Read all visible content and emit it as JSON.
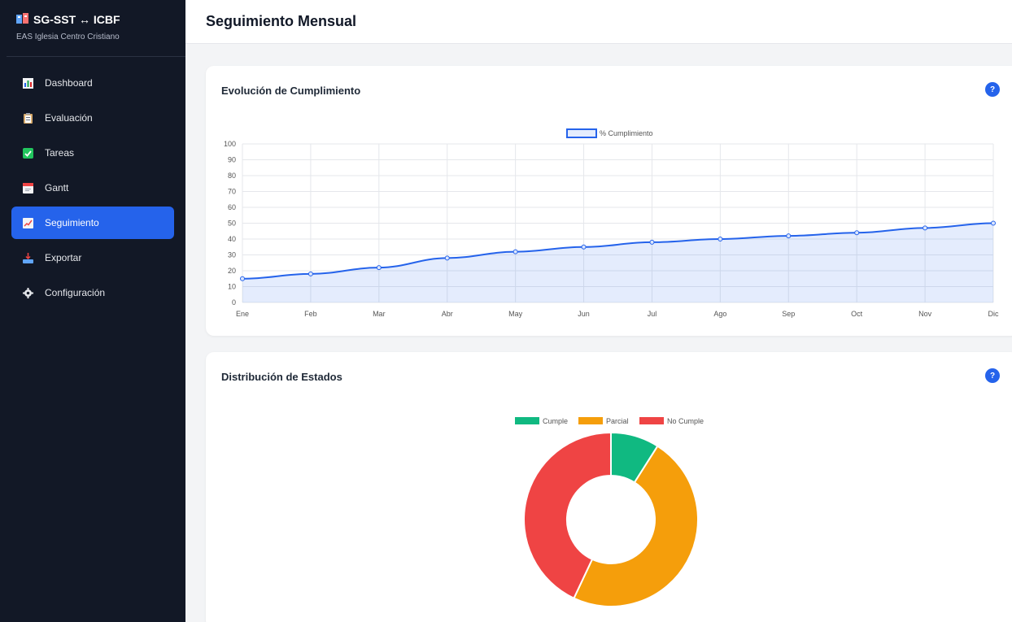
{
  "app": {
    "title": "SG-SST ↔ ICBF",
    "subtitle": "EAS Iglesia Centro Cristiano"
  },
  "sidebar": {
    "items": [
      {
        "label": "Dashboard",
        "icon": "bar-chart-icon",
        "active": false
      },
      {
        "label": "Evaluación",
        "icon": "clipboard-icon",
        "active": false
      },
      {
        "label": "Tareas",
        "icon": "check-icon",
        "active": false
      },
      {
        "label": "Gantt",
        "icon": "calendar-icon",
        "active": false
      },
      {
        "label": "Seguimiento",
        "icon": "trend-chart-icon",
        "active": true
      },
      {
        "label": "Exportar",
        "icon": "inbox-tray-icon",
        "active": false
      },
      {
        "label": "Configuración",
        "icon": "gear-icon",
        "active": false
      }
    ]
  },
  "header": {
    "title": "Seguimiento Mensual"
  },
  "cards": {
    "evolution": {
      "title": "Evolución de Cumplimiento",
      "help": "?"
    },
    "distribution": {
      "title": "Distribución de Estados",
      "help": "?"
    }
  },
  "chart_data": [
    {
      "type": "line",
      "fill": true,
      "categories": [
        "Ene",
        "Feb",
        "Mar",
        "Abr",
        "May",
        "Jun",
        "Jul",
        "Ago",
        "Sep",
        "Oct",
        "Nov",
        "Dic"
      ],
      "series": [
        {
          "name": "% Cumplimiento",
          "values": [
            15,
            18,
            22,
            28,
            32,
            35,
            38,
            40,
            42,
            44,
            47,
            50
          ],
          "color": "#2563eb"
        }
      ],
      "ylim": [
        0,
        100
      ],
      "yticks": [
        0,
        10,
        20,
        30,
        40,
        50,
        60,
        70,
        80,
        90,
        100
      ],
      "legend": "top-center",
      "grid": true
    },
    {
      "type": "pie",
      "donut": true,
      "labels": [
        "Cumple",
        "Parcial",
        "No Cumple"
      ],
      "values": [
        9,
        48,
        43
      ],
      "colors": [
        "#10b981",
        "#f59e0b",
        "#ef4444"
      ],
      "legend": "top-center"
    }
  ]
}
